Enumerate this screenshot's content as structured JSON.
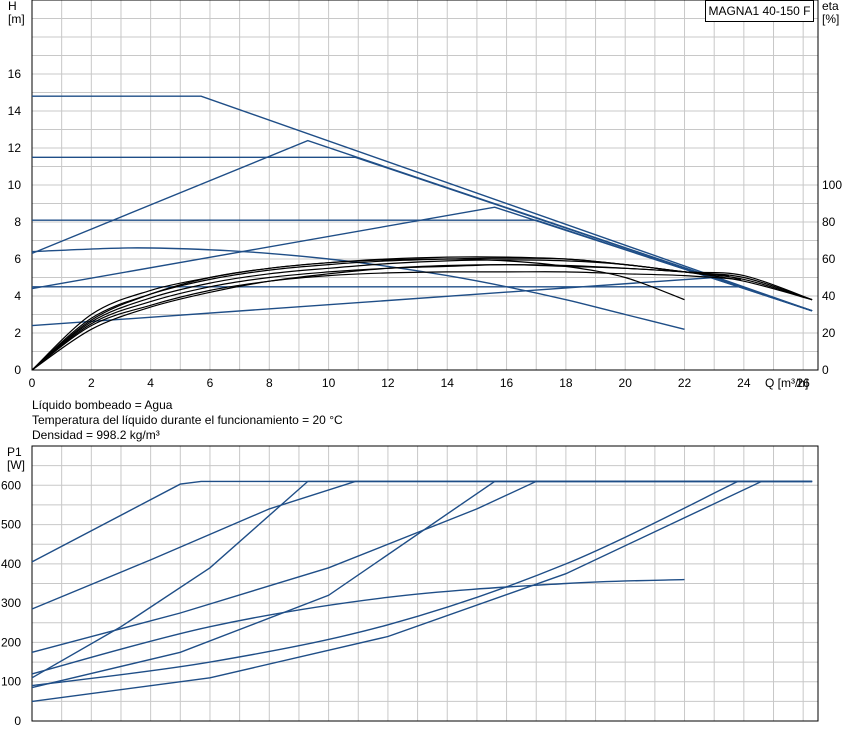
{
  "model": "MAGNA1 40-150 F",
  "info_lines": [
    "Líquido bombeado = Agua",
    "Temperatura del líquido durante el funcionamiento = 20 °C",
    "Densidad = 998.2 kg/m³"
  ],
  "colors": {
    "curve": "#1f4e87",
    "efficiency": "#000000",
    "grid": "#c8c8c8",
    "axis": "#000000"
  },
  "chart_data": [
    {
      "type": "line",
      "xlabel": "Q [m³/h]",
      "ylabel_left": "H\n[m]",
      "ylabel_right": "eta\n[%]",
      "xlim": [
        0,
        26.5
      ],
      "ylim": [
        0,
        20
      ],
      "x_ticks": [
        0,
        2,
        4,
        6,
        8,
        10,
        12,
        14,
        16,
        18,
        20,
        22,
        24,
        26
      ],
      "y_ticks": [
        0,
        2,
        4,
        6,
        8,
        10,
        12,
        14,
        16
      ],
      "y2_ticks": [
        0,
        20,
        40,
        60,
        80,
        100
      ],
      "y2_lim": [
        0,
        200
      ],
      "grid": true,
      "head_series": [
        {
          "x": [
            0,
            5.7,
            26.3
          ],
          "y": [
            14.8,
            14.8,
            3.2
          ]
        },
        {
          "x": [
            0,
            10.9,
            26.3
          ],
          "y": [
            11.5,
            11.5,
            3.2
          ]
        },
        {
          "x": [
            0,
            17.0,
            26.3
          ],
          "y": [
            8.1,
            8.1,
            3.2
          ]
        },
        {
          "x": [
            0,
            9.3,
            26.3
          ],
          "y": [
            6.3,
            12.4,
            3.2
          ]
        },
        {
          "x": [
            0,
            15.6,
            26.3
          ],
          "y": [
            4.4,
            8.8,
            3.2
          ]
        },
        {
          "x": [
            0,
            24.0
          ],
          "y": [
            4.5,
            4.5
          ]
        },
        {
          "x": [
            0,
            23.0
          ],
          "y": [
            2.4,
            5.0
          ]
        },
        {
          "x": [
            0,
            3.3,
            6.0,
            8.0,
            10.0,
            12.0,
            14.0,
            16.0,
            18.0,
            20.0,
            22.0
          ],
          "y": [
            6.4,
            6.6,
            6.5,
            6.3,
            6.0,
            5.6,
            5.1,
            4.5,
            3.8,
            3.0,
            2.2
          ]
        }
      ],
      "efficiency_series": [
        {
          "x": [
            0,
            2,
            4,
            6,
            8,
            10,
            12,
            14,
            16,
            18,
            20,
            22,
            24,
            26.3
          ],
          "y": [
            0,
            30,
            43,
            50,
            55,
            58,
            60,
            61,
            61,
            60,
            57,
            53,
            48,
            38
          ]
        },
        {
          "x": [
            0,
            2,
            4,
            6,
            8,
            10,
            12,
            14,
            16,
            18,
            20,
            22,
            24,
            26.3
          ],
          "y": [
            0,
            28,
            41,
            49,
            54,
            57,
            59,
            60,
            60.5,
            60,
            57,
            53,
            49,
            38
          ]
        },
        {
          "x": [
            0,
            2,
            4,
            6,
            8,
            10,
            12,
            14,
            16,
            18,
            20,
            22,
            24,
            26.3
          ],
          "y": [
            0,
            26,
            39,
            47,
            52,
            55,
            57.5,
            59,
            59.5,
            59,
            57,
            53,
            50,
            38
          ]
        },
        {
          "x": [
            0,
            2,
            4,
            6,
            8,
            10,
            12,
            14,
            16,
            18,
            20,
            22,
            24,
            26.3
          ],
          "y": [
            0,
            25,
            37,
            45,
            50,
            53,
            55,
            56,
            57,
            56,
            55,
            53,
            51,
            38
          ]
        },
        {
          "x": [
            0,
            2,
            4,
            6,
            8,
            10,
            12,
            14,
            16,
            18,
            20,
            22,
            23.9
          ],
          "y": [
            0,
            24,
            35,
            43,
            48,
            51,
            52.5,
            53,
            53,
            53,
            52,
            51,
            49
          ]
        },
        {
          "x": [
            0,
            2,
            4,
            6,
            8,
            10,
            12,
            14,
            16,
            18,
            20,
            22
          ],
          "y": [
            0,
            27,
            41,
            50,
            55,
            58,
            59.5,
            60,
            59,
            56,
            50,
            38
          ]
        },
        {
          "x": [
            0,
            2,
            4,
            6,
            8,
            10,
            12,
            14,
            16,
            18,
            20,
            22,
            23.5
          ],
          "y": [
            0,
            22,
            34,
            42,
            48,
            52,
            55,
            56.5,
            57,
            56.5,
            55,
            53,
            51
          ]
        }
      ]
    },
    {
      "type": "line",
      "ylabel": "P1\n[W]",
      "xlim": [
        0,
        26.5
      ],
      "ylim": [
        0,
        700
      ],
      "x_ticks": [
        0,
        2,
        4,
        6,
        8,
        10,
        12,
        14,
        16,
        18,
        20,
        22,
        24,
        26
      ],
      "y_ticks": [
        0,
        100,
        200,
        300,
        400,
        500,
        600
      ],
      "grid": true,
      "series": [
        {
          "x": [
            0,
            5.0,
            5.7,
            26.3
          ],
          "y": [
            405,
            603,
            610,
            610
          ]
        },
        {
          "x": [
            0,
            4,
            8,
            10.9,
            26.3
          ],
          "y": [
            285,
            410,
            540,
            610,
            610
          ]
        },
        {
          "x": [
            0,
            5,
            10,
            15,
            17.0,
            26.3
          ],
          "y": [
            175,
            275,
            390,
            540,
            610,
            610
          ]
        },
        {
          "x": [
            0,
            3,
            6,
            9.3,
            26.3
          ],
          "y": [
            110,
            240,
            390,
            610,
            610
          ]
        },
        {
          "x": [
            0,
            5,
            10,
            15.6,
            26.3
          ],
          "y": [
            85,
            175,
            320,
            610,
            610
          ]
        },
        {
          "x": [
            0,
            6,
            12,
            18,
            24.6,
            26.3
          ],
          "y": [
            50,
            110,
            215,
            375,
            610,
            610
          ]
        },
        {
          "x": [
            0,
            6,
            12,
            18,
            23.8
          ],
          "y": [
            90,
            150,
            245,
            400,
            610
          ]
        },
        {
          "x": [
            0,
            6,
            12,
            18,
            22.0
          ],
          "y": [
            120,
            240,
            315,
            350,
            360
          ]
        }
      ]
    }
  ]
}
